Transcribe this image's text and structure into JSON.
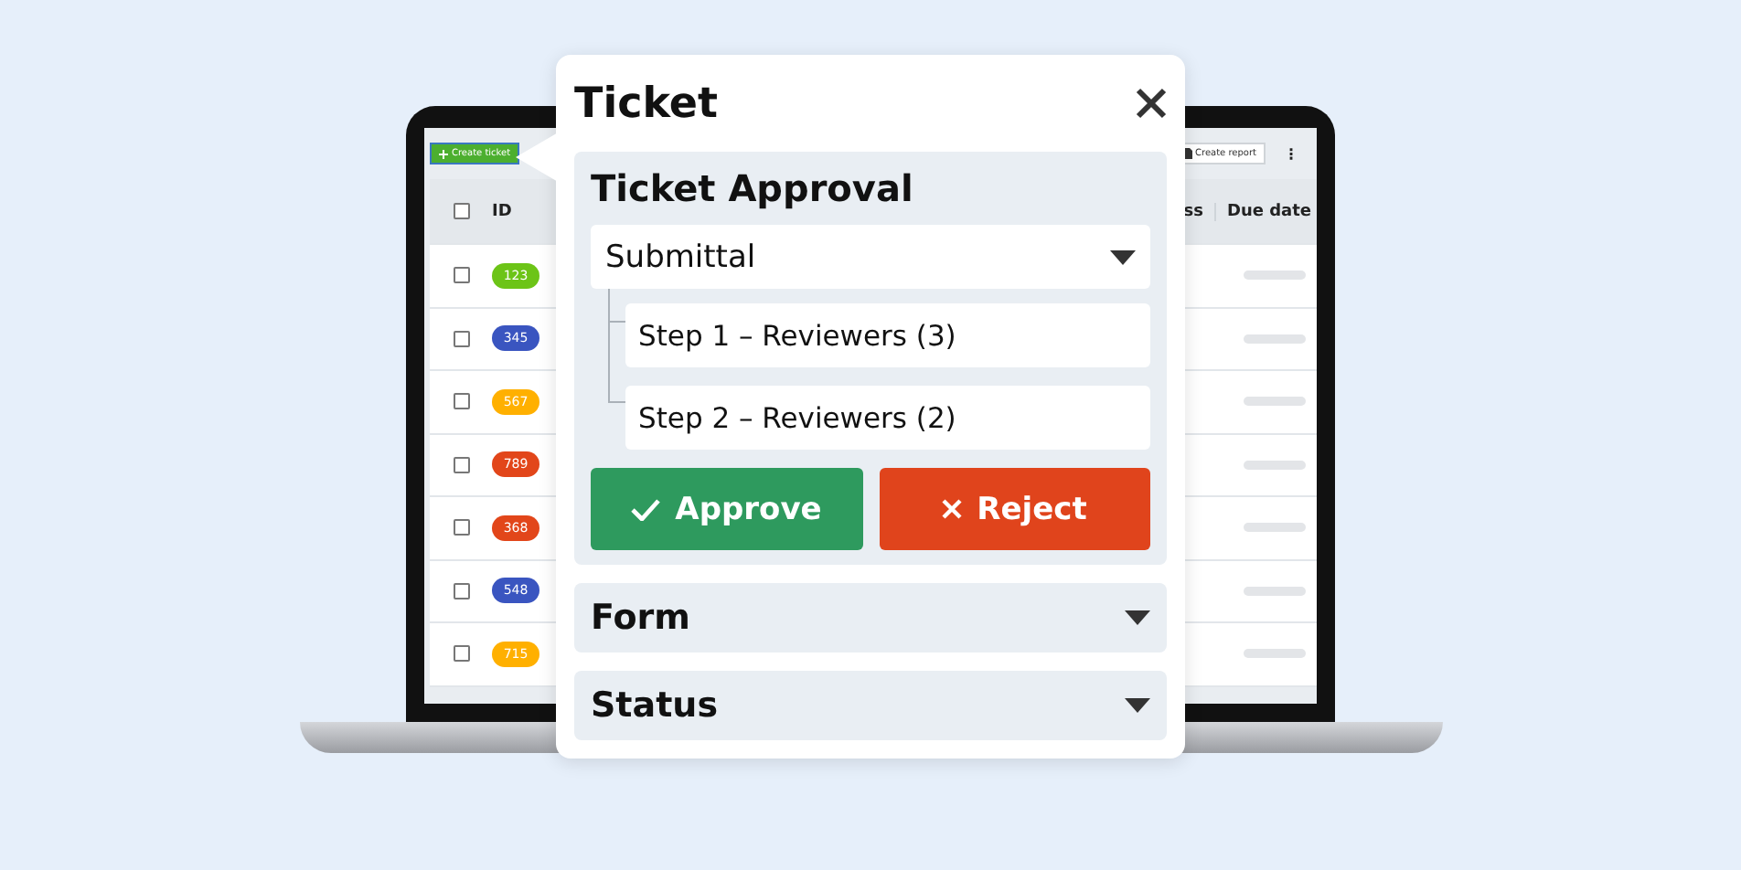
{
  "toolbar": {
    "create_button": "Create ticket",
    "report_button": "Create report",
    "more": "⋮"
  },
  "table": {
    "columns": [
      {
        "label": "ID"
      },
      {
        "label": "ss"
      },
      {
        "label": "Due date"
      }
    ],
    "header_checked": false,
    "rows": [
      {
        "id": "123",
        "color": "#6cc417",
        "checked": false
      },
      {
        "id": "345",
        "color": "#3a55c0",
        "checked": false
      },
      {
        "id": "567",
        "color": "#ffb000",
        "checked": false
      },
      {
        "id": "789",
        "color": "#e2461a",
        "checked": false
      },
      {
        "id": "368",
        "color": "#e2461a",
        "checked": false
      },
      {
        "id": "548",
        "color": "#3a55c0",
        "checked": false
      },
      {
        "id": "715",
        "color": "#ffb000",
        "checked": false
      }
    ]
  },
  "popup": {
    "title": "Ticket",
    "sections": [
      {
        "title": "Ticket Approval",
        "expanded": true,
        "dropdown": {
          "value": "Submittal"
        },
        "steps": [
          "Step 1 – Reviewers (3)",
          "Step 2 – Reviewers (2)"
        ],
        "actions": [
          {
            "kind": "approve",
            "label": "Approve"
          },
          {
            "kind": "reject",
            "label": "Reject"
          }
        ]
      },
      {
        "title": "Form",
        "expanded": false
      },
      {
        "title": "Status",
        "expanded": false
      }
    ]
  }
}
